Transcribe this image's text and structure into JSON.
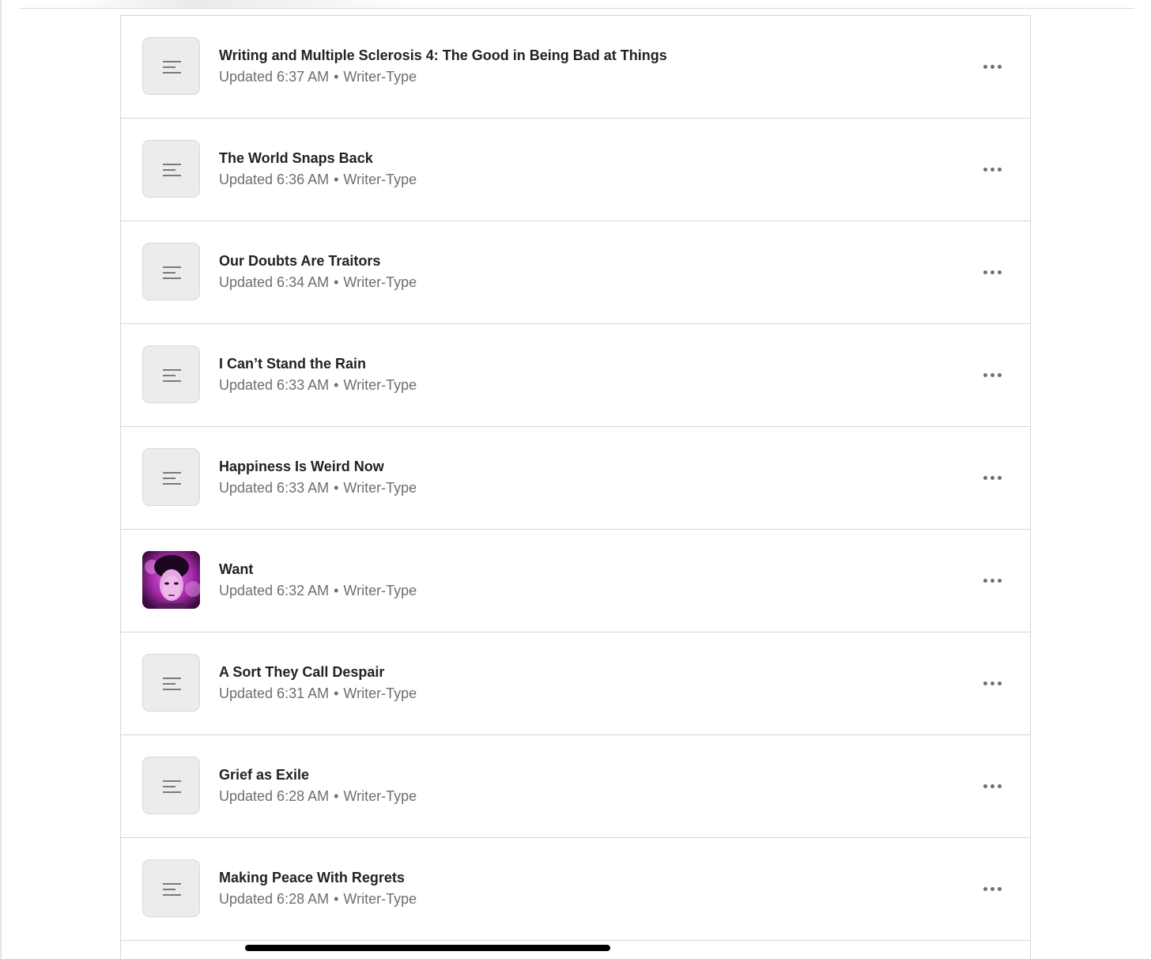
{
  "posts": [
    {
      "title": "Writing and Multiple Sclerosis 4: The Good in Being Bad at Things",
      "updated": "Updated 6:37 AM",
      "author": "Writer-Type",
      "thumbnail": "text-lines-icon"
    },
    {
      "title": "The World Snaps Back",
      "updated": "Updated 6:36 AM",
      "author": "Writer-Type",
      "thumbnail": "text-lines-icon"
    },
    {
      "title": "Our Doubts Are Traitors",
      "updated": "Updated 6:34 AM",
      "author": "Writer-Type",
      "thumbnail": "text-lines-icon"
    },
    {
      "title": "I Can’t Stand the Rain",
      "updated": "Updated 6:33 AM",
      "author": "Writer-Type",
      "thumbnail": "text-lines-icon"
    },
    {
      "title": "Happiness Is Weird Now",
      "updated": "Updated 6:33 AM",
      "author": "Writer-Type",
      "thumbnail": "text-lines-icon"
    },
    {
      "title": "Want",
      "updated": "Updated 6:32 AM",
      "author": "Writer-Type",
      "thumbnail": "photo"
    },
    {
      "title": "A Sort They Call Despair",
      "updated": "Updated 6:31 AM",
      "author": "Writer-Type",
      "thumbnail": "text-lines-icon"
    },
    {
      "title": "Grief as Exile",
      "updated": "Updated 6:28 AM",
      "author": "Writer-Type",
      "thumbnail": "text-lines-icon"
    },
    {
      "title": "Making Peace With Regrets",
      "updated": "Updated 6:28 AM",
      "author": "Writer-Type",
      "thumbnail": "text-lines-icon"
    }
  ],
  "separator": "•",
  "colors": {
    "title": "#222222",
    "meta": "#6e6e6e",
    "border": "#d6d6d6",
    "thumb_bg": "#ececec",
    "photo_tint": "#c43fc4"
  }
}
